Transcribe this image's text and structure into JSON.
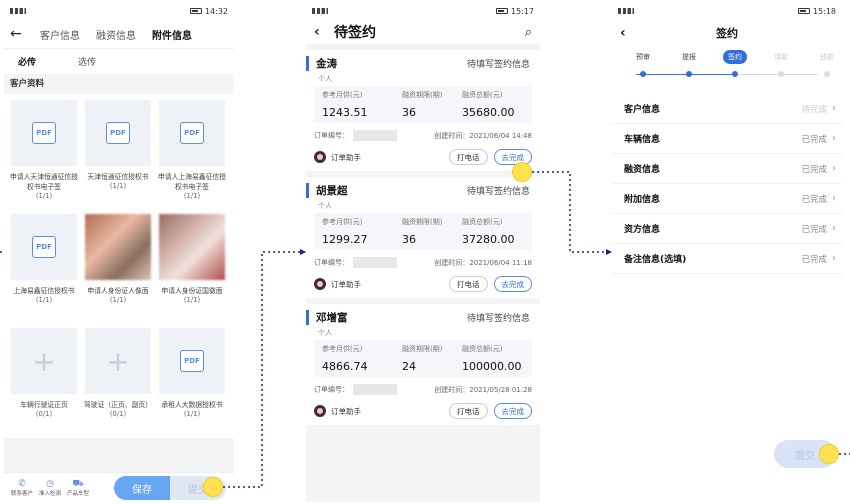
{
  "screen1": {
    "status": {
      "time": "14:32",
      "battery": "78"
    },
    "tabs": [
      "客户信息",
      "融资信息",
      "附件信息"
    ],
    "active_tab": 2,
    "subtabs": [
      "必传",
      "选传"
    ],
    "section": "客户资料",
    "docs": [
      {
        "kind": "pdf",
        "label": "申请人天津恒通征信授权书电子签",
        "count": "(1/1)"
      },
      {
        "kind": "pdf",
        "label": "天津恒通征信授权书",
        "count": "(1/1)"
      },
      {
        "kind": "pdf",
        "label": "申请人上海易鑫征信授权书电子签",
        "count": "(1/1)"
      },
      {
        "kind": "pdf",
        "label": "上海易鑫征信授权书",
        "count": "(1/1)"
      },
      {
        "kind": "photo1",
        "label": "申请人身份证人像面",
        "count": "(1/1)"
      },
      {
        "kind": "photo2",
        "label": "申请人身份证国徽面",
        "count": "(1/1)"
      },
      {
        "kind": "empty",
        "label": "车辆行驶证正页",
        "count": "(0/1)"
      },
      {
        "kind": "empty",
        "label": "驾驶证（正页、副页）",
        "count": "(0/1)"
      },
      {
        "kind": "pdf",
        "label": "承租人大数据授权书",
        "count": "(1/1)"
      }
    ],
    "footer_icons": [
      {
        "icon": "phone-icon",
        "glyph": "✆",
        "label": "联系客户"
      },
      {
        "icon": "clock-icon",
        "glyph": "◷",
        "label": "准入检测"
      },
      {
        "icon": "car-icon",
        "glyph": "⛟",
        "label": "产品车型"
      }
    ],
    "save": "保存",
    "submit": "提交"
  },
  "screen2": {
    "status": {
      "time": "15:17"
    },
    "title": "待签约",
    "cards": [
      {
        "name": "金涛",
        "status": "待填写签约信息",
        "type": "个人",
        "h1": "参考月供(元)",
        "h2": "融资期限(期)",
        "h3": "融资总额(元)",
        "v1": "1243.51",
        "v2": "36",
        "v3": "35680.00",
        "order_label": "订单编号：",
        "created": "创建时间：2021/06/04 14:48",
        "assistant": "订单助手",
        "call": "打电话",
        "complete": "去完成"
      },
      {
        "name": "胡景超",
        "status": "待填写签约信息",
        "type": "个人",
        "h1": "参考月供(元)",
        "h2": "融资期限(期)",
        "h3": "融资总额(元)",
        "v1": "1299.27",
        "v2": "36",
        "v3": "37280.00",
        "order_label": "订单编号：",
        "created": "创建时间：2021/06/04 11:18",
        "assistant": "订单助手",
        "call": "打电话",
        "complete": "去完成"
      },
      {
        "name": "邓增富",
        "status": "待填写签约信息",
        "type": "个人",
        "h1": "参考月供(元)",
        "h2": "融资期限(期)",
        "h3": "融资总额(元)",
        "v1": "4866.74",
        "v2": "24",
        "v3": "100000.00",
        "order_label": "订单编号：",
        "created": "创建时间：2021/05/28 01:28",
        "assistant": "订单助手",
        "call": "打电话",
        "complete": "去完成"
      }
    ]
  },
  "screen3": {
    "status": {
      "time": "15:18"
    },
    "title": "签约",
    "steps": [
      "预审",
      "提报",
      "签约",
      "请款",
      "放款"
    ],
    "current_step": 2,
    "rows": [
      {
        "label": "客户信息",
        "value": "待完成",
        "pending": true
      },
      {
        "label": "车辆信息",
        "value": "已完成",
        "pending": false
      },
      {
        "label": "融资信息",
        "value": "已完成",
        "pending": false
      },
      {
        "label": "附加信息",
        "value": "已完成",
        "pending": false
      },
      {
        "label": "资方信息",
        "value": "已完成",
        "pending": false
      },
      {
        "label": "备注信息(选填)",
        "value": "已完成",
        "pending": false
      }
    ],
    "submit": "提交"
  },
  "colors": {
    "primary": "#2f6fde",
    "highlight": "#ffe24d",
    "connector": "#1a237e"
  }
}
